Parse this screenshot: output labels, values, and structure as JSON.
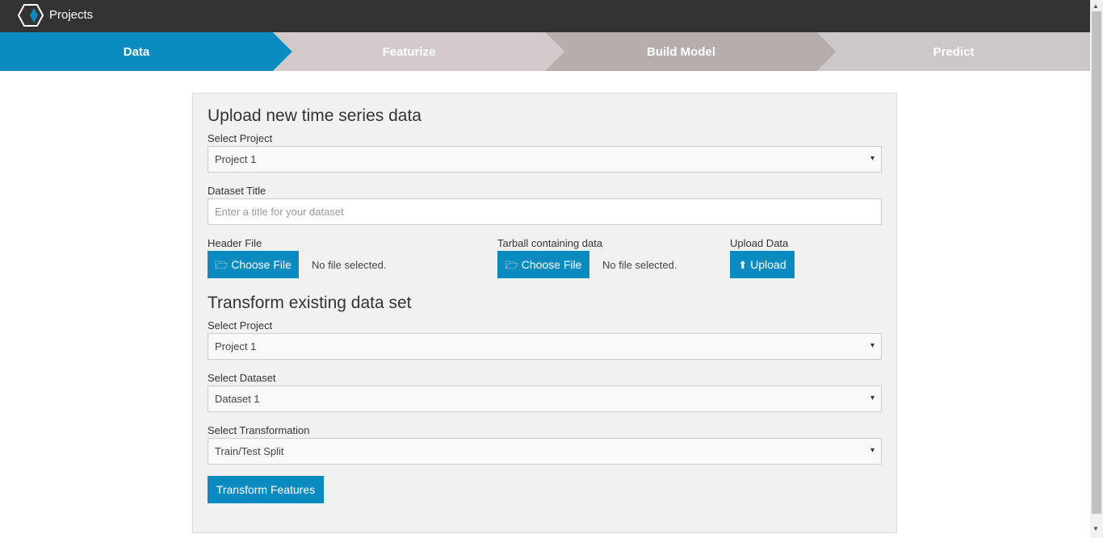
{
  "app": {
    "title": "Projects",
    "logo_icon": "hexagon-logo-icon",
    "brand_color": "#0a8bc0"
  },
  "steps": [
    {
      "label": "Data",
      "active": true,
      "color": "#0a8bc0"
    },
    {
      "label": "Featurize",
      "active": false,
      "color": "#d3cbcb"
    },
    {
      "label": "Build Model",
      "active": false,
      "color": "#b8adad"
    },
    {
      "label": "Predict",
      "active": false,
      "color": "#cdc7c7"
    }
  ],
  "upload": {
    "heading": "Upload new time series data",
    "project_label": "Select Project",
    "project_value": "Project 1",
    "dataset_title_label": "Dataset Title",
    "dataset_title_placeholder": "Enter a title for your dataset",
    "dataset_title_value": "",
    "header_file": {
      "label": "Header File",
      "button": "Choose File",
      "button_icon": "folder-open-icon",
      "status": "No file selected."
    },
    "tarball": {
      "label": "Tarball containing data",
      "button": "Choose File",
      "button_icon": "folder-open-icon",
      "status": "No file selected."
    },
    "upload_data": {
      "label": "Upload Data",
      "button": "Upload",
      "button_icon": "upload-icon"
    }
  },
  "transform": {
    "heading": "Transform existing data set",
    "project_label": "Select Project",
    "project_value": "Project 1",
    "dataset_label": "Select Dataset",
    "dataset_value": "Dataset 1",
    "transformation_label": "Select Transformation",
    "transformation_value": "Train/Test Split",
    "button": "Transform Features"
  }
}
